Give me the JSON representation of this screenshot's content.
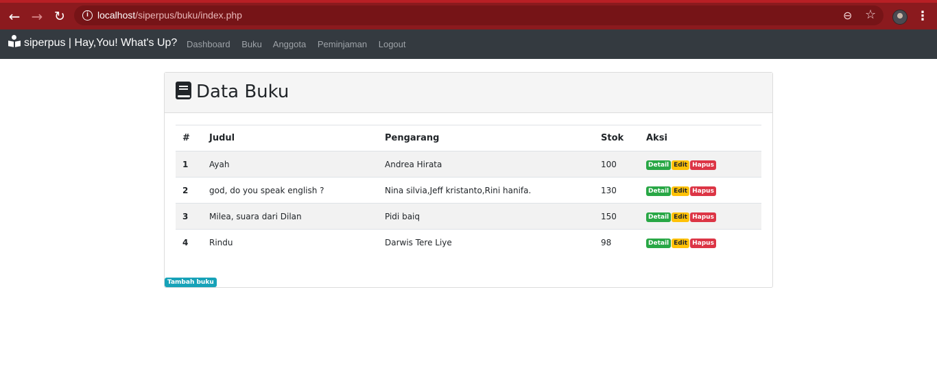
{
  "browser": {
    "url_host": "localhost",
    "url_path": "/siperpus/buku/index.php"
  },
  "navbar": {
    "brand": "siperpus | Hay,You! What's Up?",
    "links": [
      "Dashboard",
      "Buku",
      "Anggota",
      "Peminjaman",
      "Logout"
    ]
  },
  "card": {
    "title": "Data Buku",
    "table": {
      "headers": [
        "#",
        "Judul",
        "Pengarang",
        "Stok",
        "Aksi"
      ],
      "rows": [
        {
          "no": "1",
          "judul": "Ayah",
          "pengarang": "Andrea Hirata",
          "stok": "100"
        },
        {
          "no": "2",
          "judul": "god, do you speak english ?",
          "pengarang": "Nina silvia,Jeff kristanto,Rini hanifa.",
          "stok": "130"
        },
        {
          "no": "3",
          "judul": "Milea, suara dari Dilan",
          "pengarang": "Pidi baiq",
          "stok": "150"
        },
        {
          "no": "4",
          "judul": "Rindu",
          "pengarang": "Darwis Tere Liye",
          "stok": "98"
        }
      ]
    },
    "actions": {
      "detail": "Detail",
      "edit": "Edit",
      "hapus": "Hapus"
    },
    "add_button": "Tambah buku"
  },
  "colors": {
    "browser_bar": "#8b1a1e",
    "navbar": "#343a40",
    "detail": "#28a745",
    "edit": "#ffc107",
    "hapus": "#dc3545",
    "add": "#17a2b8"
  },
  "icons": [
    "back-arrow-icon",
    "forward-arrow-icon",
    "reload-icon",
    "info-icon",
    "zoom-icon",
    "star-icon",
    "menu-kebab-icon",
    "brand-reader-icon",
    "book-icon"
  ]
}
